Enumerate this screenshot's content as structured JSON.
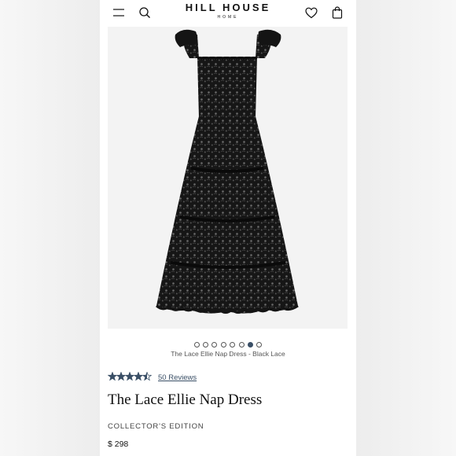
{
  "header": {
    "brand_name": "HILL HOUSE",
    "brand_sub": "HOME",
    "icons": [
      "menu-icon",
      "search-icon",
      "heart-icon",
      "shopping-bag-icon"
    ]
  },
  "gallery": {
    "image": "black-lace-midi-dress",
    "slide_count": 8,
    "active_slide": 7,
    "caption": "The Lace Ellie Nap Dress - Black Lace"
  },
  "product": {
    "rating": 4.5,
    "rating_max": 5,
    "reviews_label": "50 Reviews",
    "title": "The Lace Ellie Nap Dress",
    "edition": "COLLECTOR'S EDITION",
    "price": "$ 298"
  },
  "colors": {
    "accent": "#3a4f66",
    "text": "#111111",
    "dress": "#141414",
    "photo_bg": "#f3f3f3"
  }
}
